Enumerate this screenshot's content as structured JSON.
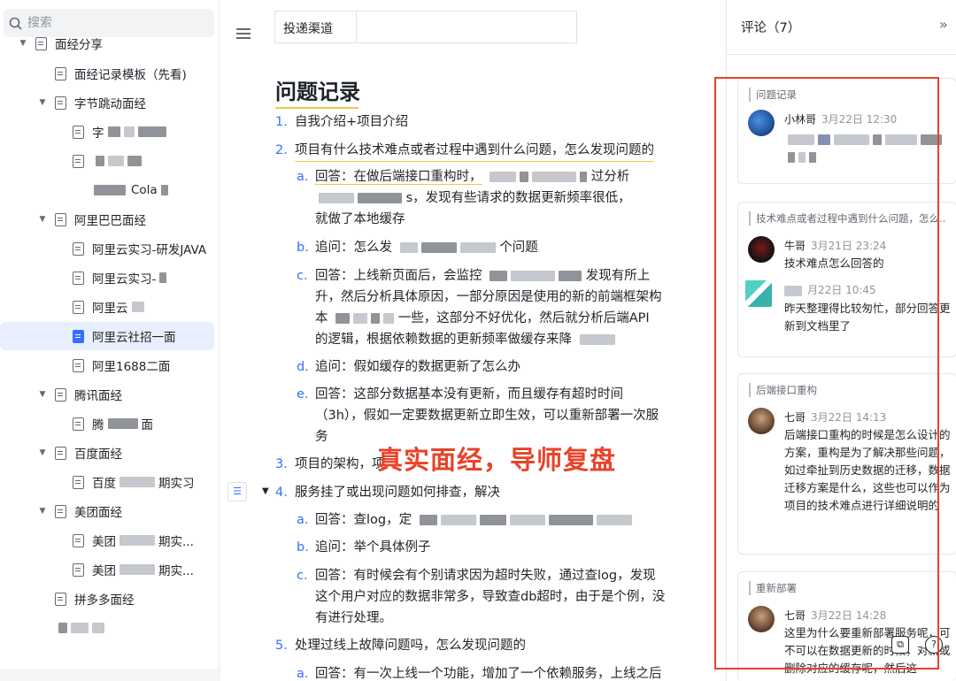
{
  "sidebar": {
    "search_placeholder": "搜索",
    "items": [
      {
        "label": "面经分享"
      },
      {
        "label": "面经记录模板（先看)"
      },
      {
        "label": "字节跳动面经"
      },
      {
        "label": "字"
      },
      {
        "label": ""
      },
      {
        "label": "Cola"
      },
      {
        "label": "阿里巴巴面经"
      },
      {
        "label": "阿里云实习-研发JAVA"
      },
      {
        "label": "阿里云实习-"
      },
      {
        "label": "阿里云"
      },
      {
        "label": "阿里云社招一面"
      },
      {
        "label": "阿里1688二面"
      },
      {
        "label": "腾讯面经"
      },
      {
        "label": "腾"
      },
      {
        "label": "面"
      },
      {
        "label": "百度面经"
      },
      {
        "label": "百度"
      },
      {
        "label": "期实习"
      },
      {
        "label": "美团面经"
      },
      {
        "label": "美团"
      },
      {
        "label": "期实..."
      },
      {
        "label": "美团"
      },
      {
        "label": "期实..."
      },
      {
        "label": "拼多多面经"
      }
    ]
  },
  "document": {
    "table_cell_label": "投递渠道",
    "title": "问题记录",
    "watermark": "真实面经，导师复盘",
    "lines": {
      "n1": "1.",
      "l1": "自我介绍+项目介绍",
      "n2": "2.",
      "l2": "项目有什么技术难点或者过程中遇到什么问题，怎么发现问题的",
      "a1n": "a.",
      "a1": "回答：在做后端接口重构时，",
      "a1b": "过分析",
      "a1c": "s，发现有些请求的数据更新频率很低，",
      "a1d": "就做了本地缓存",
      "b1n": "b.",
      "b1": "追问：怎么发",
      "b1b": "个问题",
      "c1n": "c.",
      "c1": "回答：上线新页面后，会监控",
      "c1b": "发现有所上",
      "c1c": "升，然后分析具体原因，一部分原因是使用的新的前端框架构",
      "c1d": "本",
      "c1e": "一些，这部分不好优化，然后就分析后端API",
      "c1f": "的逻辑，根据依赖数据的更新频率做缓存来降",
      "d1n": "d.",
      "d1": "追问：假如缓存的数据更新了怎么办",
      "e1n": "e.",
      "e1": "回答：这部分数据基本没有更新，而且缓存有超时时间",
      "e1b": "（3h），假如一定要数据更新立即生效，可以重新部署一次服",
      "e1c": "务",
      "n3": "3.",
      "l3": "项目的架构，项",
      "n4": "4.",
      "l4": "服务挂了或出现问题如何排查，解决",
      "a2n": "a.",
      "a2": "回答：查log，定",
      "b2n": "b.",
      "b2": "追问：举个具体例子",
      "c2n": "c.",
      "c2": "回答：有时候会有个别请求因为超时失败，通过查log，发现",
      "c2b": "这个用户对应的数据非常多，导致查db超时，由于是个例，没",
      "c2c": "有进行处理。",
      "n5": "5.",
      "l5": "处理过线上故障问题吗，怎么发现问题的",
      "a3n": "a.",
      "a3": "回答：有一次上线一个功能，增加了一个依赖服务，上线之后"
    }
  },
  "comments": {
    "title": "评论（7）",
    "cards": [
      {
        "quote": "问题记录",
        "entries": [
          {
            "name": "小林哥",
            "time": "3月22日 12:30",
            "text": ""
          }
        ]
      },
      {
        "quote": "技术难点或者过程中遇到什么问题，怎么...",
        "entries": [
          {
            "name": "牛哥",
            "time": "3月21日 23:24",
            "text": "技术难点怎么回答的"
          },
          {
            "name": "",
            "time": "月22日 10:45",
            "text": "昨天整理得比较匆忙，部分回答更新到文档里了"
          }
        ]
      },
      {
        "quote": "后端接口重构",
        "entries": [
          {
            "name": "七哥",
            "time": "3月22日 14:13",
            "text": "后端接口重构的时候是怎么设计的方案，重构是为了解决那些问题，如过牵扯到历史数据的迁移，数据迁移方案是什么，这些也可以作为项目的技术难点进行详细说明的"
          }
        ]
      },
      {
        "quote": "重新部署",
        "entries": [
          {
            "name": "七哥",
            "time": "3月22日 14:28",
            "text": "这里为什么要重新部署服务呢，可不可以在数据更新的时候，对新或删除对应的缓存呢，然后这"
          }
        ]
      }
    ]
  },
  "colors": {
    "accent": "#3370ff",
    "highlight_box": "#e8432a",
    "underline": "#f2c94c"
  }
}
